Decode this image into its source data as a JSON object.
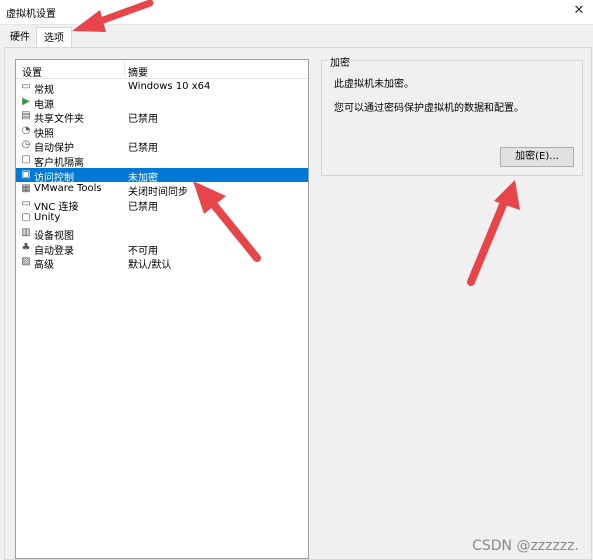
{
  "window": {
    "title": "虚拟机设置",
    "close_glyph": "✕"
  },
  "tabs": [
    {
      "label": "硬件"
    },
    {
      "label": "选项"
    }
  ],
  "list": {
    "header_setting": "设置",
    "header_summary": "摘要",
    "items": [
      {
        "icon": "▭",
        "label": "常规",
        "summary": "Windows 10 x64"
      },
      {
        "icon": "▶",
        "label": "电源",
        "summary": ""
      },
      {
        "icon": "▤",
        "label": "共享文件夹",
        "summary": "已禁用"
      },
      {
        "icon": "◔",
        "label": "快照",
        "summary": ""
      },
      {
        "icon": "◷",
        "label": "自动保护",
        "summary": "已禁用"
      },
      {
        "icon": "▢",
        "label": "客户机隔离",
        "summary": ""
      },
      {
        "icon": "▣",
        "label": "访问控制",
        "summary": "未加密"
      },
      {
        "icon": "▦",
        "label": "VMware Tools",
        "summary": "关闭时间同步"
      },
      {
        "icon": "▭",
        "label": "VNC 连接",
        "summary": "已禁用"
      },
      {
        "icon": "▢",
        "label": "Unity",
        "summary": ""
      },
      {
        "icon": "▥",
        "label": "设备视图",
        "summary": ""
      },
      {
        "icon": "♣",
        "label": "自动登录",
        "summary": "不可用"
      },
      {
        "icon": "▨",
        "label": "高级",
        "summary": "默认/默认"
      }
    ]
  },
  "encryption": {
    "group_title": "加密",
    "status_text": "此虚拟机未加密。",
    "hint_text": "您可以通过密码保护虚拟机的数据和配置。",
    "button_label": "加密(E)..."
  },
  "watermark": "CSDN @zzzzzz.",
  "colors": {
    "selection": "#0078d7",
    "arrow": "#e8454b"
  }
}
